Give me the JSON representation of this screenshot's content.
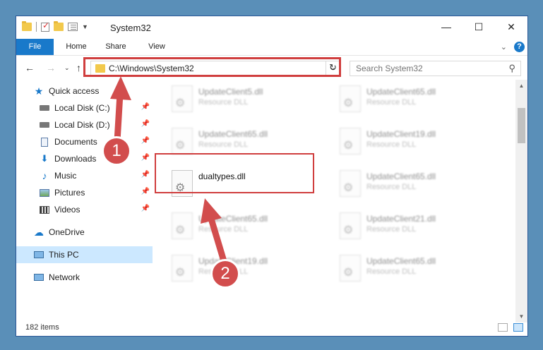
{
  "window": {
    "title": "System32",
    "minimize_icon": "—",
    "maximize_icon": "☐",
    "close_icon": "✕"
  },
  "ribbon": {
    "tabs": [
      "File",
      "Home",
      "Share",
      "View"
    ]
  },
  "address": {
    "path": "C:\\Windows\\System32",
    "search_placeholder": "Search System32"
  },
  "nav": {
    "items": [
      {
        "label": "Quick access",
        "icon": "star-icon"
      },
      {
        "label": "Local Disk (C:)",
        "icon": "drive-icon",
        "pinned": true
      },
      {
        "label": "Local Disk (D:)",
        "icon": "drive-icon",
        "pinned": true
      },
      {
        "label": "Documents",
        "icon": "documents-icon",
        "pinned": true
      },
      {
        "label": "Downloads",
        "icon": "downloads-icon",
        "pinned": true
      },
      {
        "label": "Music",
        "icon": "music-icon",
        "pinned": true
      },
      {
        "label": "Pictures",
        "icon": "pictures-icon",
        "pinned": true
      },
      {
        "label": "Videos",
        "icon": "videos-icon",
        "pinned": true
      },
      {
        "label": "OneDrive",
        "icon": "onedrive-icon"
      },
      {
        "label": "This PC",
        "icon": "pc-icon",
        "selected": true
      },
      {
        "label": "Network",
        "icon": "network-icon"
      }
    ]
  },
  "files": [
    {
      "name": "UpdateClient5.dll",
      "type": "Resource DLL"
    },
    {
      "name": "UpdateClient65.dll",
      "type": "Resource DLL"
    },
    {
      "name": "UpdateClient65.dll",
      "type": "Resource DLL"
    },
    {
      "name": "UpdateClient19.dll",
      "type": "Resource DLL"
    },
    {
      "name": "dualtypes.dll",
      "type": ""
    },
    {
      "name": "UpdateClient65.dll",
      "type": "Resource DLL"
    },
    {
      "name": "UpdateClient65.dll",
      "type": "Resource DLL"
    },
    {
      "name": "UpdateClient21.dll",
      "type": "Resource DLL"
    },
    {
      "name": "UpdateClient19.dll",
      "type": "Resource DLL"
    },
    {
      "name": "UpdateClient65.dll",
      "type": "Resource DLL"
    }
  ],
  "status": {
    "item_count": "182 items"
  },
  "annotations": {
    "step1": "1",
    "step2": "2",
    "accent": "#d03e3e"
  }
}
